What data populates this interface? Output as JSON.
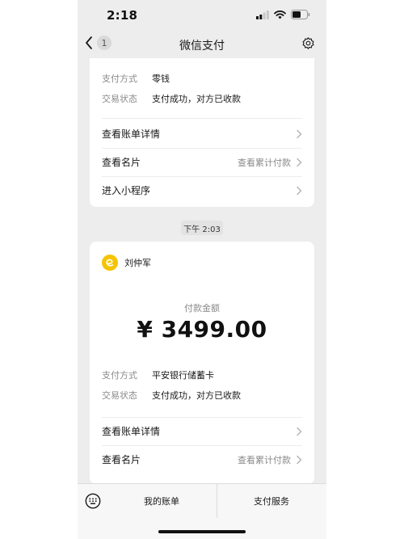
{
  "status_bar": {
    "time": "2:18"
  },
  "nav": {
    "title": "微信支付",
    "unread_count": "1"
  },
  "top_card": {
    "rows": [
      {
        "label": "支付方式",
        "value": "零钱"
      },
      {
        "label": "交易状态",
        "value": "支付成功，对方已收款"
      }
    ],
    "links": [
      {
        "label": "查看账单详情",
        "hint": ""
      },
      {
        "label": "查看名片",
        "hint": "查看累计付款"
      },
      {
        "label": "进入小程序",
        "hint": ""
      }
    ]
  },
  "timestamp": "下午 2:03",
  "bottom_card": {
    "merchant_name": "刘仲军",
    "amount_label": "付款金额",
    "amount": "¥ 3499.00",
    "rows": [
      {
        "label": "支付方式",
        "value": "平安银行储蓄卡"
      },
      {
        "label": "交易状态",
        "value": "支付成功，对方已收款"
      }
    ],
    "links": [
      {
        "label": "查看账单详情",
        "hint": ""
      },
      {
        "label": "查看名片",
        "hint": "查看累计付款"
      }
    ]
  },
  "bottom_menu": {
    "bill": "我的账单",
    "service": "支付服务"
  },
  "icons": {
    "back": "chevron-left-icon",
    "settings": "gear-icon",
    "keyboard": "keyboard-icon",
    "merchant": "merchant-avatar-icon",
    "chevron": "chevron-right-icon"
  },
  "colors": {
    "background": "#ededed",
    "card": "#ffffff",
    "avatar": "#f5c400",
    "muted_text": "#8a8a8a"
  }
}
